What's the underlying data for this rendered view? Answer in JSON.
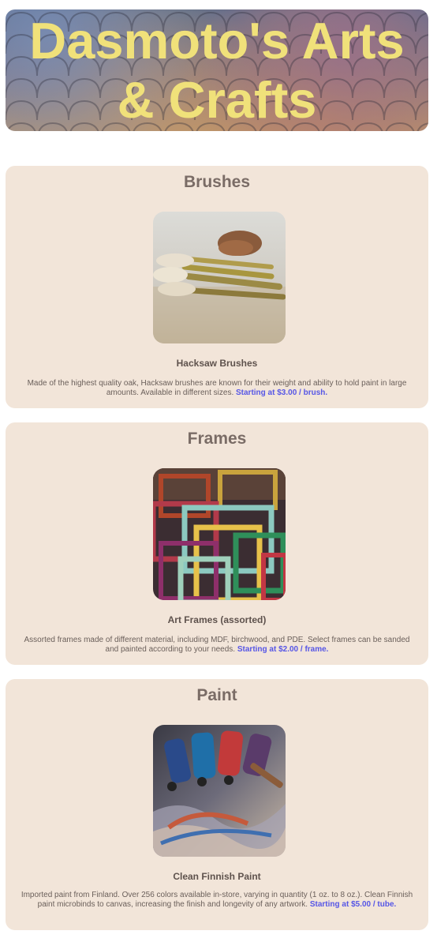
{
  "header": {
    "title": "Dasmoto's Arts & Crafts"
  },
  "sections": [
    {
      "heading": "Brushes",
      "image_alt": "brushes-photo",
      "product": "Hacksaw Brushes",
      "description": "Made of the highest quality oak, Hacksaw brushes are known for their weight and ability to hold paint in large amounts. Available in different sizes. ",
      "price": "Starting at $3.00 / brush."
    },
    {
      "heading": "Frames",
      "image_alt": "frames-photo",
      "product": "Art Frames (assorted)",
      "description": "Assorted frames made of different material, including MDF, birchwood, and PDE. Select frames can be sanded and painted according to your needs. ",
      "price": "Starting at $2.00 / frame."
    },
    {
      "heading": "Paint",
      "image_alt": "paint-photo",
      "product": "Clean Finnish Paint",
      "description": "Imported paint from Finland. Over 256 colors available in-store, varying in quantity (1 oz. to 8 oz.). Clean Finnish paint microbinds to canvas, increasing the finish and longevity of any artwork. ",
      "price": "Starting at $5.00 / tube."
    }
  ],
  "colors": {
    "title": "#f0e17a",
    "section_bg": "#f2e5d9",
    "price": "#5656e6"
  }
}
